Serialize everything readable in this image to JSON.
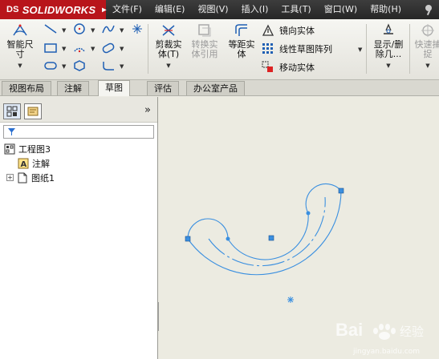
{
  "app": {
    "brand": "SOLIDWORKS",
    "brand_prefix": "DS",
    "brand_color": "#b8151b"
  },
  "menu": {
    "items": [
      "文件(F)",
      "编辑(E)",
      "视图(V)",
      "插入(I)",
      "工具(T)",
      "窗口(W)",
      "帮助(H)"
    ]
  },
  "ribbon": {
    "smart_dimension": {
      "line1": "智能尺",
      "line2": "寸"
    },
    "trim": {
      "line1": "剪裁实",
      "line2": "体(T)"
    },
    "convert": {
      "line1": "转换实",
      "line2": "体引用"
    },
    "offset": {
      "line1": "等距实",
      "line2": "体"
    },
    "mirror": "镜向实体",
    "linear_pattern": "线性草图阵列",
    "move": "移动实体",
    "display_delete": {
      "line1": "显示/删",
      "line2": "除几..."
    },
    "quick_snap": {
      "line1": "快速捕",
      "line2": "捉"
    }
  },
  "tabs": [
    "视图布局",
    "注解",
    "草图",
    "评估",
    "办公室产品"
  ],
  "active_tab": "草图",
  "tree": {
    "root": "工程图3",
    "annotations": "注解",
    "sheet": "图纸1"
  },
  "colors": {
    "sketch": "#3a8fe0",
    "canvas": "#ecebe1",
    "ribbon_top": "#f6f6f2"
  },
  "watermark": {
    "text": "Bai",
    "suffix": "经验",
    "url": "jingyan.baidu.com"
  }
}
